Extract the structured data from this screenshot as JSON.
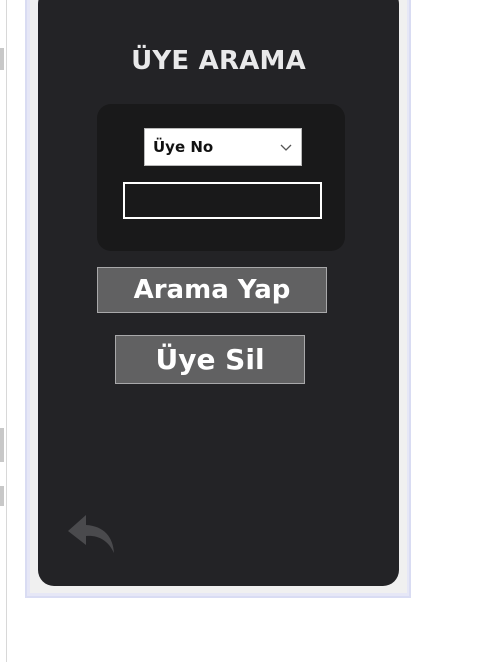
{
  "window": {
    "title": "ÜYE ARAMA"
  },
  "search": {
    "field_select": {
      "selected": "Üye No"
    },
    "query_input": {
      "value": "",
      "placeholder": ""
    }
  },
  "buttons": {
    "search_label": "Arama Yap",
    "delete_label": "Üye Sil"
  },
  "icons": {
    "back": "reply-arrow-icon",
    "dropdown": "chevron-down-icon"
  },
  "colors": {
    "panel_bg": "#232326",
    "search_box_bg": "#19191a",
    "button_bg": "#616162",
    "title_text": "#e9e9ea"
  }
}
